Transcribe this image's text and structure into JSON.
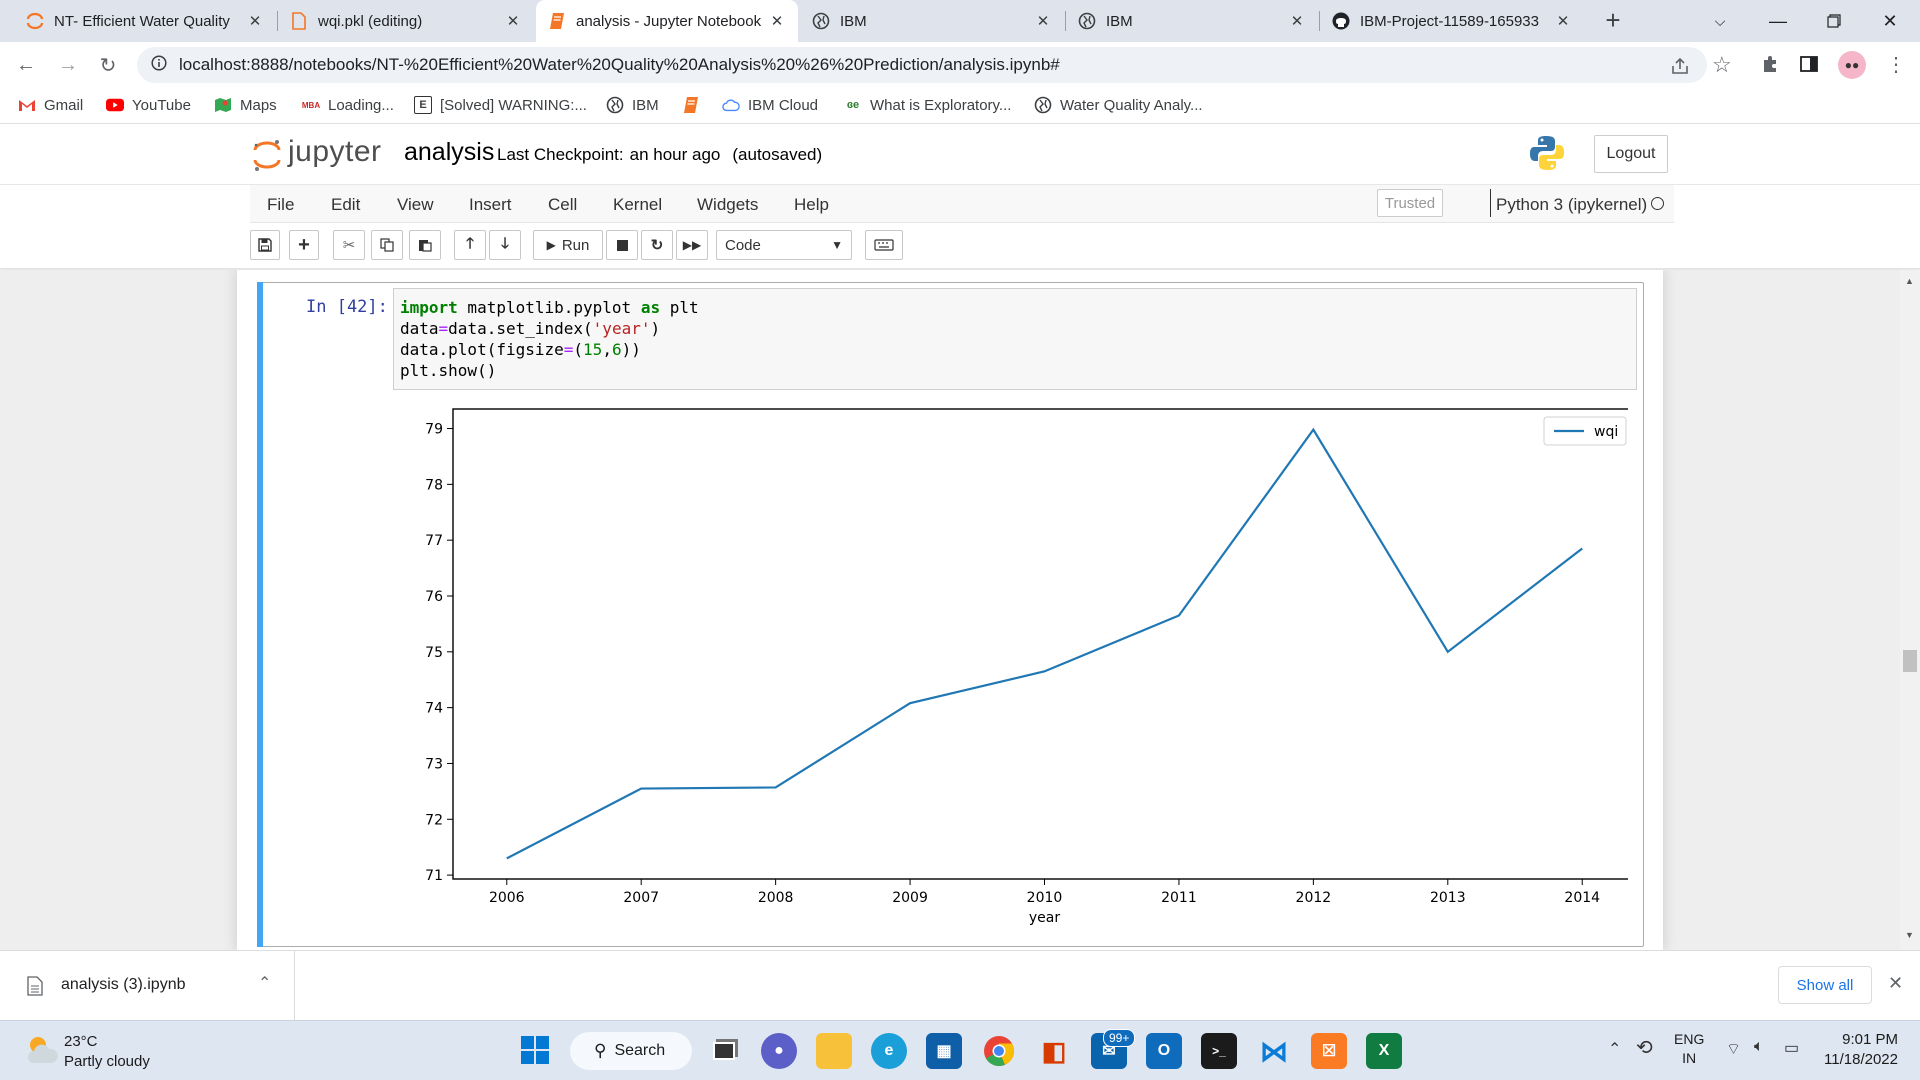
{
  "browser": {
    "tabs": [
      {
        "label": "NT- Efficient Water Quality",
        "icon": "jupyter-icon"
      },
      {
        "label": "wqi.pkl (editing)",
        "icon": "file-icon"
      },
      {
        "label": "analysis - Jupyter Notebook",
        "icon": "notebook-icon"
      },
      {
        "label": "IBM",
        "icon": "globe-icon"
      },
      {
        "label": "IBM",
        "icon": "globe-icon"
      },
      {
        "label": "IBM-Project-11589-165933",
        "icon": "github-icon"
      }
    ],
    "active_tab": 2,
    "url": "localhost:8888/notebooks/NT-%20Efficient%20Water%20Quality%20Analysis%20%26%20Prediction/analysis.ipynb#",
    "bookmarks": [
      {
        "label": "Gmail",
        "icon": "gmail-icon"
      },
      {
        "label": "YouTube",
        "icon": "youtube-icon"
      },
      {
        "label": "Maps",
        "icon": "maps-icon"
      },
      {
        "label": "Loading...",
        "icon": "loading-icon"
      },
      {
        "label": "[Solved] WARNING:...",
        "icon": "e-icon"
      },
      {
        "label": "IBM",
        "icon": "globe-icon"
      },
      {
        "label": "",
        "icon": "notebook-icon"
      },
      {
        "label": "IBM Cloud",
        "icon": "cloud-icon"
      },
      {
        "label": "What is Exploratory...",
        "icon": "ge-icon"
      },
      {
        "label": "Water Quality Analy...",
        "icon": "globe-icon"
      }
    ]
  },
  "jupyter": {
    "logo_text": "jupyter",
    "notebook_name": "analysis",
    "checkpoint_label": "Last Checkpoint:",
    "checkpoint_time": "an hour ago",
    "autosaved": "(autosaved)",
    "logout_label": "Logout",
    "trusted_label": "Trusted",
    "kernel_label": "Python 3 (ipykernel)",
    "menu": [
      "File",
      "Edit",
      "View",
      "Insert",
      "Cell",
      "Kernel",
      "Widgets",
      "Help"
    ],
    "run_label": "Run",
    "cell_type": "Code"
  },
  "cell": {
    "prompt": "In [42]:",
    "code_lines": [
      "import matplotlib.pyplot as plt",
      "data=data.set_index('year')",
      "data.plot(figsize=(15,6))",
      "plt.show()"
    ]
  },
  "chart_data": {
    "type": "line",
    "x": [
      2006,
      2007,
      2008,
      2009,
      2010,
      2011,
      2012,
      2013,
      2014
    ],
    "series": [
      {
        "name": "wqi",
        "values": [
          71.3,
          72.55,
          72.57,
          74.08,
          74.65,
          75.65,
          78.98,
          75.0,
          76.85
        ],
        "color": "#1f77b4"
      }
    ],
    "xlabel": "year",
    "ylabel": "",
    "xlim": [
      2005.6,
      2014.4
    ],
    "ylim": [
      70.93,
      79.35
    ],
    "yticks": [
      71,
      72,
      73,
      74,
      75,
      76,
      77,
      78,
      79
    ],
    "xticks": [
      2006,
      2007,
      2008,
      2009,
      2010,
      2011,
      2012,
      2013,
      2014
    ],
    "legend": "top-right",
    "grid": false
  },
  "downloads": {
    "file_name": "analysis (3).ipynb",
    "show_all_label": "Show all"
  },
  "taskbar": {
    "weather_temp": "23°C",
    "weather_desc": "Partly cloudy",
    "search_label": "Search",
    "mail_badge": "99+",
    "lang_top": "ENG",
    "lang_bottom": "IN",
    "time": "9:01 PM",
    "date": "11/18/2022"
  }
}
